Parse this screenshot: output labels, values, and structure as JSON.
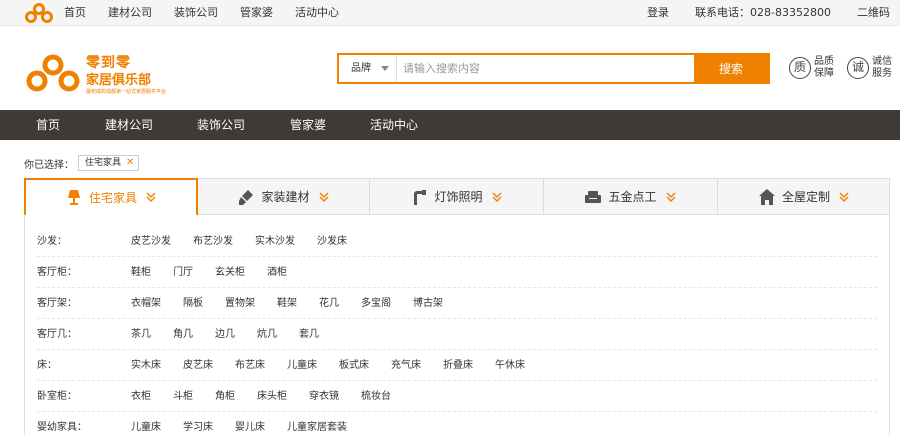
{
  "topbar": {
    "links": [
      "首页",
      "建材公司",
      "装饰公司",
      "管家婆",
      "活动中心"
    ],
    "login": "登录",
    "phone": "联系电话：028-83352800",
    "qrcode": "二维码"
  },
  "logo": {
    "line1": "零到零",
    "line2": "家居俱乐部",
    "slogan": "最权威的成都第一站式家居服务平台"
  },
  "search": {
    "select": "品牌",
    "placeholder": "请输入搜索内容",
    "button": "搜索"
  },
  "badges": [
    {
      "glyph": "质",
      "line1": "品质",
      "line2": "保障"
    },
    {
      "glyph": "诚",
      "line1": "诚信",
      "line2": "服务"
    }
  ],
  "mainnav": [
    "首页",
    "建材公司",
    "装饰公司",
    "管家婆",
    "活动中心"
  ],
  "selected": {
    "label": "你已选择：",
    "chip": "住宅家具"
  },
  "tabs": [
    {
      "label": "住宅家具",
      "icon": "lamp-icon",
      "active": true
    },
    {
      "label": "家装建材",
      "icon": "brush-icon",
      "active": false
    },
    {
      "label": "灯饰照明",
      "icon": "faucet-icon",
      "active": false
    },
    {
      "label": "五金点工",
      "icon": "sofa-icon",
      "active": false
    },
    {
      "label": "全屋定制",
      "icon": "house-icon",
      "active": false
    }
  ],
  "categories": [
    {
      "key": "沙发：",
      "items": [
        "皮艺沙发",
        "布艺沙发",
        "实木沙发",
        "沙发床"
      ]
    },
    {
      "key": "客厅柜：",
      "items": [
        "鞋柜",
        "门厅",
        "玄关柜",
        "酒柜"
      ]
    },
    {
      "key": "客厅架：",
      "items": [
        "衣帽架",
        "隔板",
        "置物架",
        "鞋架",
        "花几",
        "多宝阁",
        "博古架"
      ]
    },
    {
      "key": "客厅几：",
      "items": [
        "茶几",
        "角几",
        "边几",
        "炕几",
        "套几"
      ]
    },
    {
      "key": "床：",
      "items": [
        "实木床",
        "皮艺床",
        "布艺床",
        "儿童床",
        "板式床",
        "充气床",
        "折叠床",
        "午休床"
      ]
    },
    {
      "key": "卧室柜：",
      "items": [
        "衣柜",
        "斗柜",
        "角柜",
        "床头柜",
        "穿衣镜",
        "梳妆台"
      ]
    },
    {
      "key": "婴幼家具：",
      "items": [
        "儿童床",
        "学习床",
        "婴儿床",
        "儿童家居套装"
      ]
    }
  ],
  "colors": {
    "accent": "#f08000",
    "nav": "#3f3a37"
  }
}
